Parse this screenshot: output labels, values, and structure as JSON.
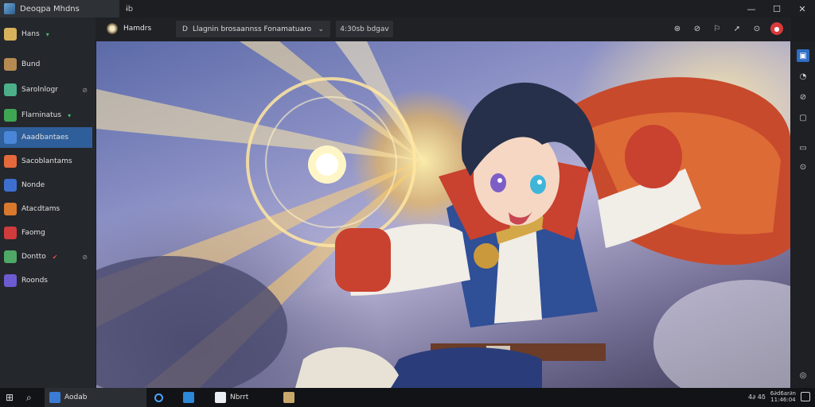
{
  "window": {
    "title": "Deoqpa Mhdns",
    "tab": "ɨb",
    "controls": [
      "—",
      "☐",
      "✕"
    ]
  },
  "sidebar": {
    "items": [
      {
        "label": "Hans",
        "badge": "▾",
        "icon": "home-icon",
        "color": "#d8b25a"
      },
      {
        "label": "Bund",
        "badge": "",
        "icon": "bundle-icon",
        "color": "#b78a52"
      },
      {
        "label": "Sarolnlogr",
        "badge": "",
        "aux": "⊘",
        "icon": "tag-icon",
        "color": "#4caf8a"
      },
      {
        "label": "Flarninatus",
        "badge": "▾",
        "icon": "sheet-icon",
        "color": "#3fa653"
      },
      {
        "label": "Aaadbantaes",
        "badge": "",
        "icon": "monitor-icon",
        "color": "#4a86d8",
        "active": true
      },
      {
        "label": "Sacoblantams",
        "badge": "",
        "icon": "doc-icon",
        "color": "#e46a3c"
      },
      {
        "label": "Nonde",
        "badge": "",
        "icon": "window-icon",
        "color": "#3d6fd1"
      },
      {
        "label": "Atacdtams",
        "badge": "",
        "icon": "ball-icon",
        "color": "#d9792e"
      },
      {
        "label": "Faomg",
        "badge": "",
        "icon": "flag-icon",
        "color": "#d03b3b"
      },
      {
        "label": "Dontto",
        "badge": "✔",
        "aux": "⊘",
        "icon": "cube-icon",
        "color": "#4fa865"
      },
      {
        "label": "Roonds",
        "badge": "",
        "icon": "image-icon",
        "color": "#6d5bd1"
      }
    ]
  },
  "toolbar": {
    "crumb": "Hamdrs",
    "dropdown_icon": "D",
    "dropdown_value": "Llagnin brosaannss Fonamatuaro",
    "chip": "4:30sb bdgav",
    "icons": [
      "⊛",
      "⊘",
      "⚐",
      "➚",
      "⊙",
      "●"
    ]
  },
  "rightbar": {
    "icons": [
      "▣",
      "◔",
      "⊘",
      "▢",
      "▭",
      "⊙",
      "◎"
    ]
  },
  "taskbar": {
    "start": "⊞",
    "search": "⌕",
    "active_app": "Aodab",
    "app2": "Nbrrt",
    "tray_text": "4∂ 4δ",
    "clock_top": "6∂d6ar∂n",
    "clock_bottom": "11:46:04"
  }
}
